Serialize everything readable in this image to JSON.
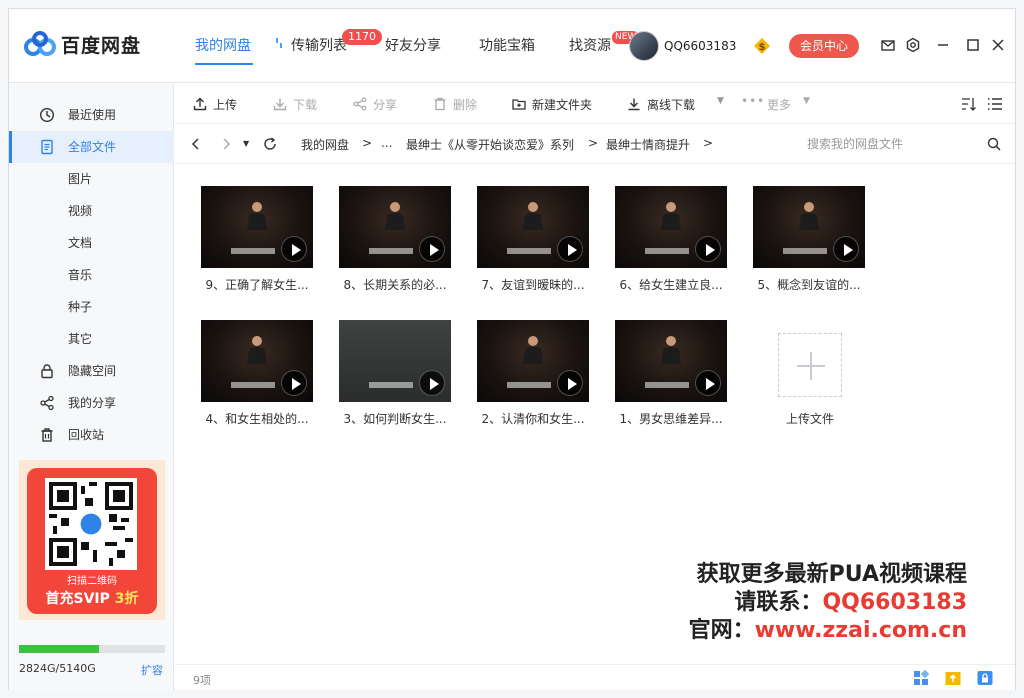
{
  "app": {
    "name": "百度网盘",
    "account": "QQ6603183",
    "member_btn": "会员中心"
  },
  "nav": {
    "my_disk": "我的网盘",
    "transfer": "传输列表",
    "transfer_badge": "1170",
    "friends": "好友分享",
    "tools": "功能宝箱",
    "find": "找资源",
    "find_badge": "NEW"
  },
  "sidebar": {
    "items": [
      {
        "label": "最近使用",
        "icon": "clock-icon"
      },
      {
        "label": "全部文件",
        "icon": "file-icon",
        "active": true
      },
      {
        "label": "图片"
      },
      {
        "label": "视频"
      },
      {
        "label": "文档"
      },
      {
        "label": "音乐"
      },
      {
        "label": "种子"
      },
      {
        "label": "其它"
      },
      {
        "label": "隐藏空间",
        "icon": "lock-icon"
      },
      {
        "label": "我的分享",
        "icon": "share-icon"
      },
      {
        "label": "回收站",
        "icon": "trash-icon"
      }
    ],
    "promo_scan": "扫描二维码",
    "promo_title_a": "首充SVIP",
    "promo_title_b": "3折",
    "quota_fraction": 0.5495,
    "quota_text": "2824G/5140G",
    "quota_expand": "扩容"
  },
  "toolbar": {
    "upload": "上传",
    "download": "下载",
    "share": "分享",
    "delete": "删除",
    "new_folder": "新建文件夹",
    "offline": "离线下载",
    "more": "更多"
  },
  "path": {
    "root": "我的网盘",
    "sep": ">",
    "ellipsis": "...",
    "folder1": "最绅士《从零开始谈恋爱》系列",
    "folder2": "最绅士情商提升",
    "search_placeholder": "搜索我的网盘文件"
  },
  "files": [
    {
      "name": "9、正确了解女生..."
    },
    {
      "name": "8、长期关系的必..."
    },
    {
      "name": "7、友谊到暧昧的..."
    },
    {
      "name": "6、给女生建立良..."
    },
    {
      "name": "5、概念到友谊的..."
    },
    {
      "name": "4、和女生相处的..."
    },
    {
      "name": "3、如何判断女生..."
    },
    {
      "name": "2、认清你和女生..."
    },
    {
      "name": "1、男女思维差异..."
    }
  ],
  "upload_label": "上传文件",
  "watermark": {
    "line1": "获取更多最新PUA视频课程",
    "line2_a": "请联系：",
    "line2_b": "QQ6603183",
    "line3_a": "官网：",
    "line3_b": "www.zzai.com.cn"
  },
  "status": {
    "count": "9项"
  },
  "colors": {
    "accent": "#2f83e6",
    "member": "#f0574c",
    "badge": "#f24e4e",
    "quota": "#3fbf3f",
    "watermark_red": "#e83b32"
  }
}
